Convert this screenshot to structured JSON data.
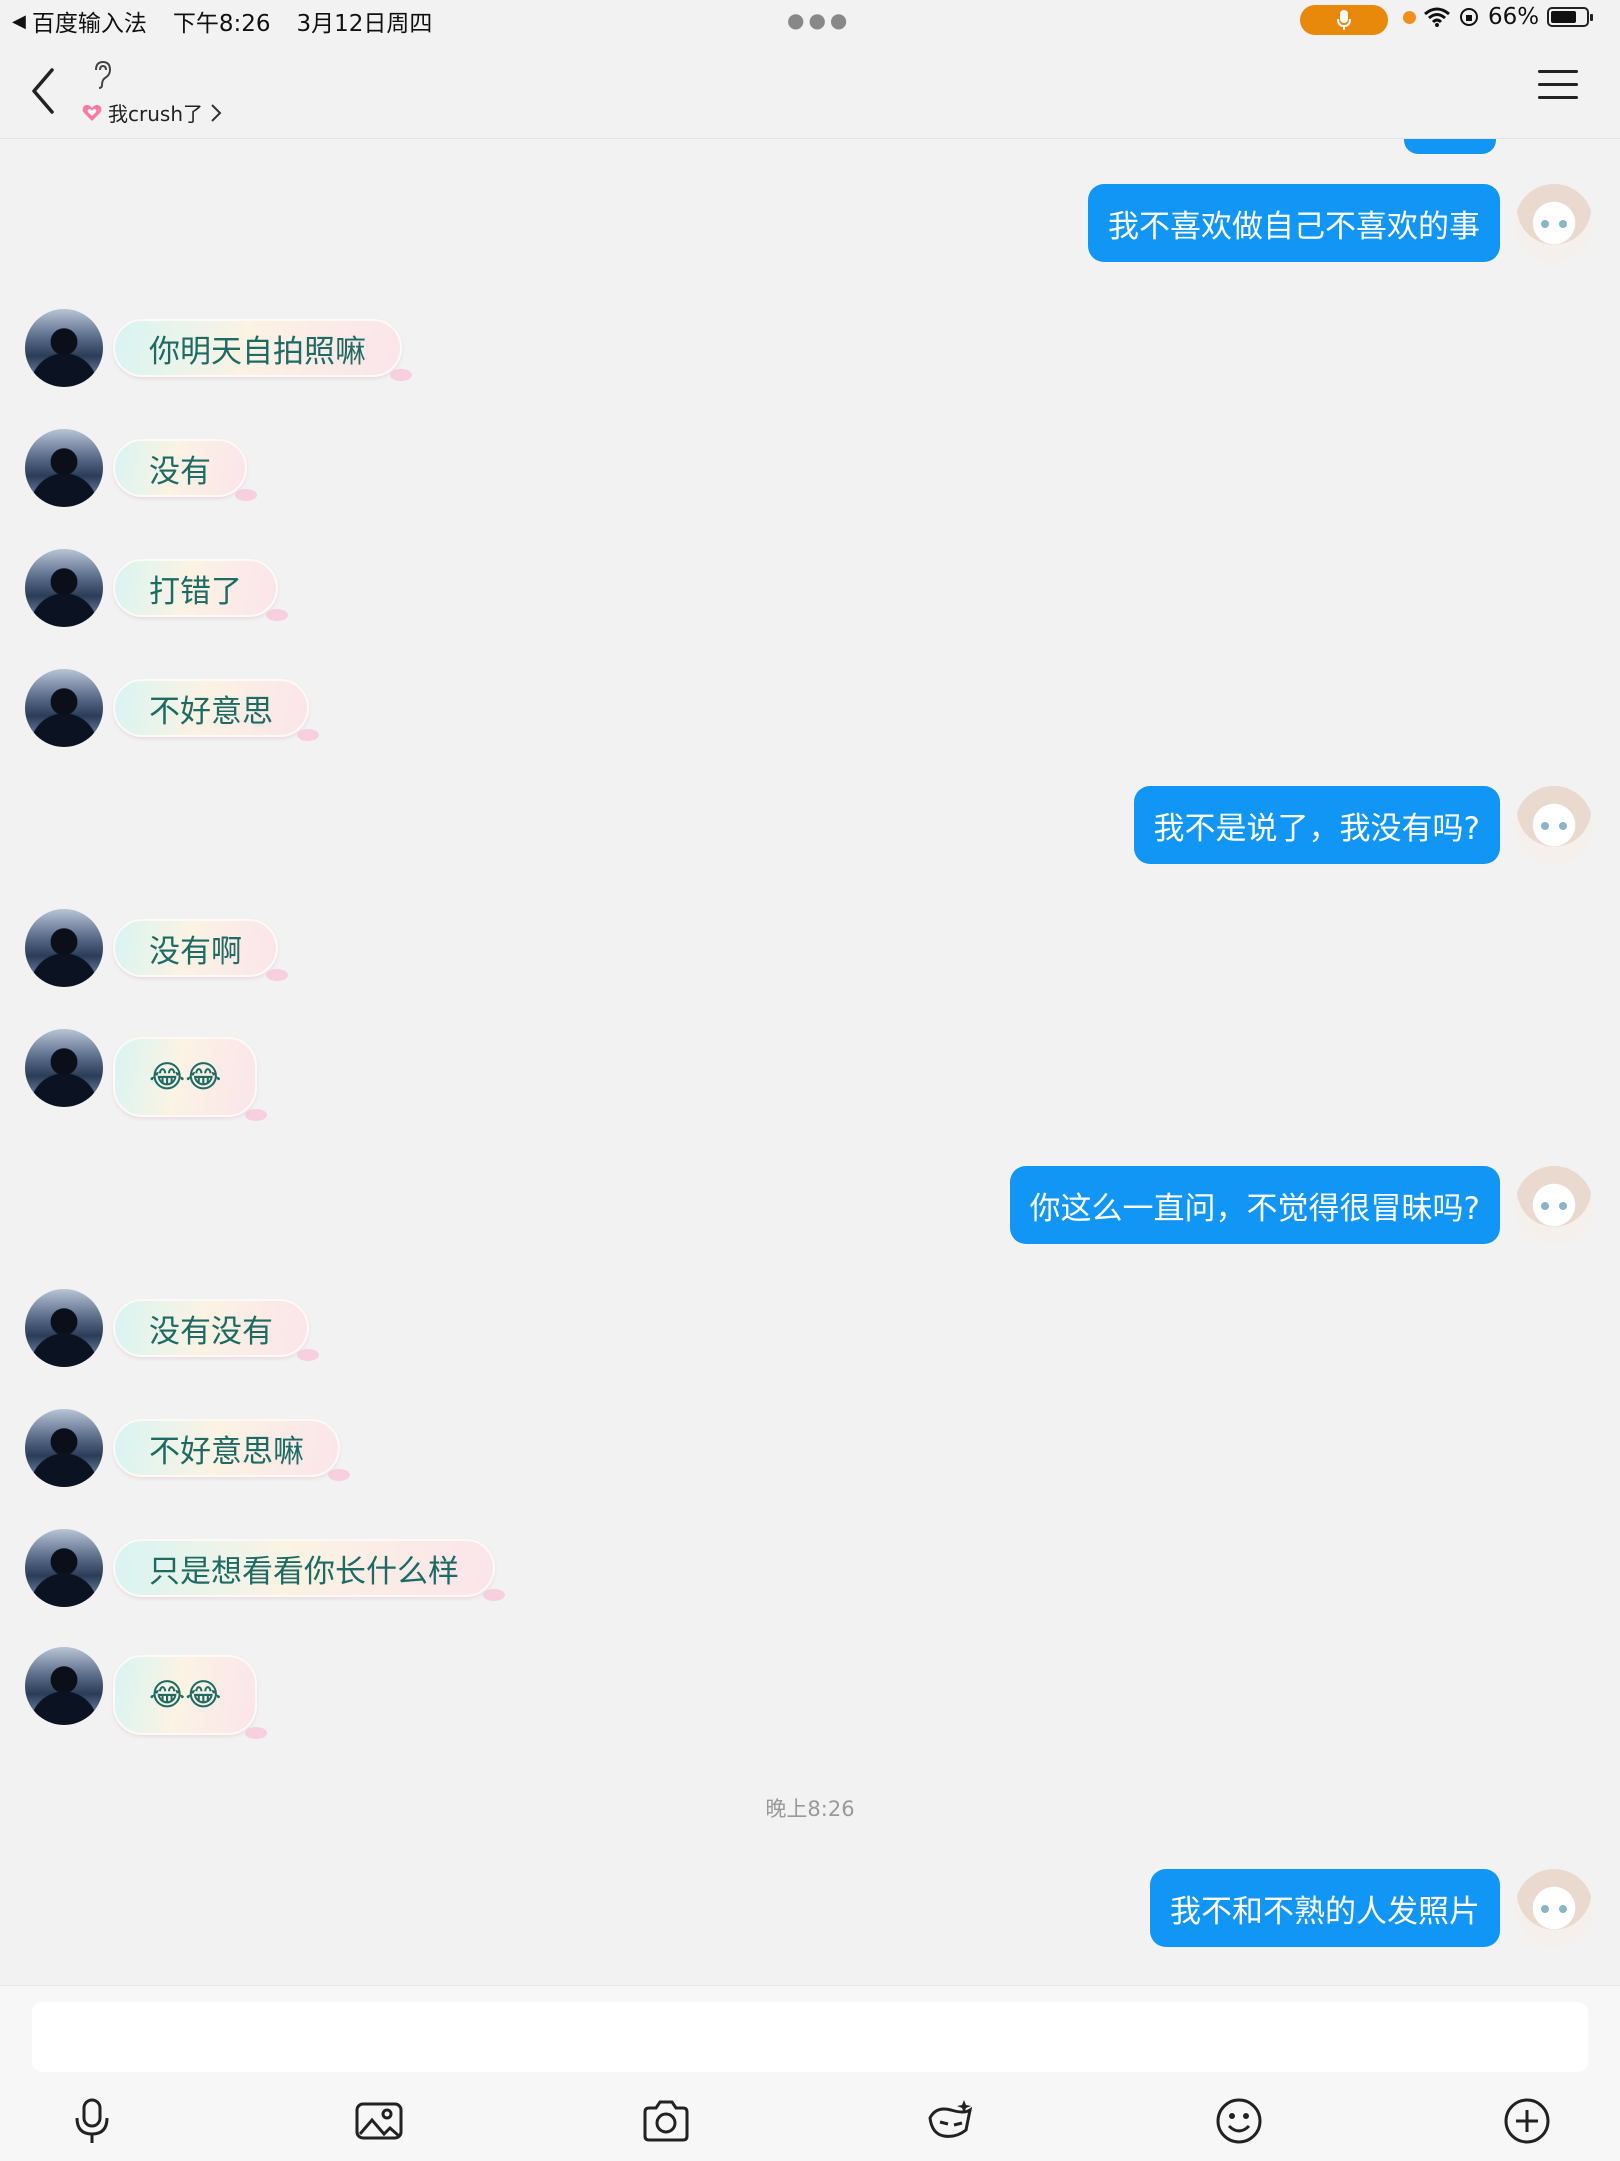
{
  "status_bar": {
    "back_app": "百度输入法",
    "time": "下午8:26",
    "date": "3月12日周四",
    "battery": "66%",
    "battery_level": 0.66,
    "mic_pill_color": "#e8890c"
  },
  "header": {
    "subtitle": "我crush了"
  },
  "messages": [
    {
      "side": "self",
      "text": "我不喜欢做自己不喜欢的事"
    },
    {
      "side": "peer",
      "text": "你明天自拍照嘛"
    },
    {
      "side": "peer",
      "text": "没有"
    },
    {
      "side": "peer",
      "text": "打错了"
    },
    {
      "side": "peer",
      "text": "不好意思"
    },
    {
      "side": "self",
      "text": "我不是说了，我没有吗?"
    },
    {
      "side": "peer",
      "text": "没有啊"
    },
    {
      "side": "peer",
      "text": "😂😂"
    },
    {
      "side": "self",
      "text": "你这么一直问，不觉得很冒昧吗?"
    },
    {
      "side": "peer",
      "text": "没有没有"
    },
    {
      "side": "peer",
      "text": "不好意思嘛"
    },
    {
      "side": "peer",
      "text": "只是想看看你长什么样"
    },
    {
      "side": "peer",
      "text": "😂😂"
    },
    {
      "side": "self",
      "text": "我不和不熟的人发照片"
    }
  ],
  "timestamp": "晚上8:26",
  "colors": {
    "self_bubble": "#1296f5",
    "peer_text": "#1d6b63",
    "background": "#f2f2f2"
  },
  "toolbar_icons": [
    "microphone-icon",
    "image-icon",
    "camera-icon",
    "red-packet-icon",
    "emoji-icon",
    "plus-icon"
  ]
}
